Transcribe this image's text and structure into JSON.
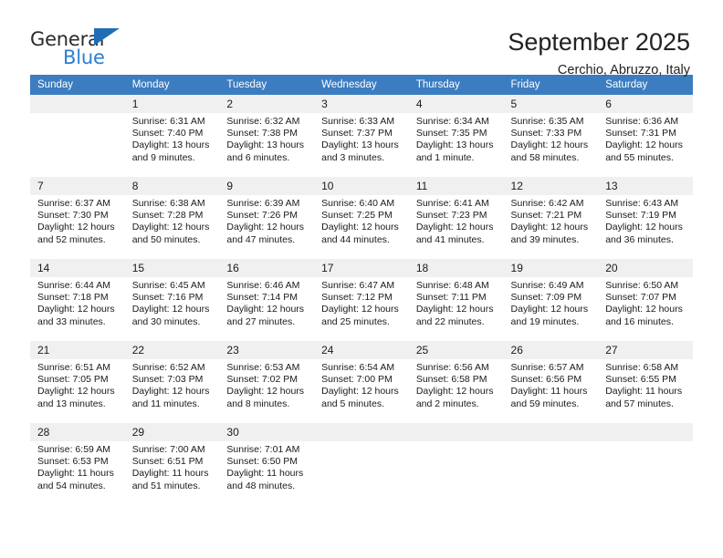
{
  "brand": {
    "line1": "General",
    "line2": "Blue",
    "triangle_color": "#1f6eb5",
    "text_color": "#2b2b2b",
    "blue_text_color": "#2a7fd4"
  },
  "header": {
    "title": "September 2025",
    "subtitle": "Cerchio, Abruzzo, Italy"
  },
  "theme": {
    "header_bg": "#3b7dc0",
    "daynum_bg": "#f0f0f0",
    "grid_line": "#3b7dc0"
  },
  "weekday_headers": [
    "Sunday",
    "Monday",
    "Tuesday",
    "Wednesday",
    "Thursday",
    "Friday",
    "Saturday"
  ],
  "labels": {
    "sunrise_prefix": "Sunrise:",
    "sunset_prefix": "Sunset:",
    "daylight_prefix": "Daylight:"
  },
  "weeks": [
    [
      {
        "day": "",
        "empty": true,
        "sunrise": "",
        "sunset": "",
        "daylight_line1": "",
        "daylight_line2": ""
      },
      {
        "day": "1",
        "sunrise": "Sunrise: 6:31 AM",
        "sunset": "Sunset: 7:40 PM",
        "daylight_line1": "Daylight: 13 hours",
        "daylight_line2": "and 9 minutes."
      },
      {
        "day": "2",
        "sunrise": "Sunrise: 6:32 AM",
        "sunset": "Sunset: 7:38 PM",
        "daylight_line1": "Daylight: 13 hours",
        "daylight_line2": "and 6 minutes."
      },
      {
        "day": "3",
        "sunrise": "Sunrise: 6:33 AM",
        "sunset": "Sunset: 7:37 PM",
        "daylight_line1": "Daylight: 13 hours",
        "daylight_line2": "and 3 minutes."
      },
      {
        "day": "4",
        "sunrise": "Sunrise: 6:34 AM",
        "sunset": "Sunset: 7:35 PM",
        "daylight_line1": "Daylight: 13 hours",
        "daylight_line2": "and 1 minute."
      },
      {
        "day": "5",
        "sunrise": "Sunrise: 6:35 AM",
        "sunset": "Sunset: 7:33 PM",
        "daylight_line1": "Daylight: 12 hours",
        "daylight_line2": "and 58 minutes."
      },
      {
        "day": "6",
        "sunrise": "Sunrise: 6:36 AM",
        "sunset": "Sunset: 7:31 PM",
        "daylight_line1": "Daylight: 12 hours",
        "daylight_line2": "and 55 minutes."
      }
    ],
    [
      {
        "day": "7",
        "sunrise": "Sunrise: 6:37 AM",
        "sunset": "Sunset: 7:30 PM",
        "daylight_line1": "Daylight: 12 hours",
        "daylight_line2": "and 52 minutes."
      },
      {
        "day": "8",
        "sunrise": "Sunrise: 6:38 AM",
        "sunset": "Sunset: 7:28 PM",
        "daylight_line1": "Daylight: 12 hours",
        "daylight_line2": "and 50 minutes."
      },
      {
        "day": "9",
        "sunrise": "Sunrise: 6:39 AM",
        "sunset": "Sunset: 7:26 PM",
        "daylight_line1": "Daylight: 12 hours",
        "daylight_line2": "and 47 minutes."
      },
      {
        "day": "10",
        "sunrise": "Sunrise: 6:40 AM",
        "sunset": "Sunset: 7:25 PM",
        "daylight_line1": "Daylight: 12 hours",
        "daylight_line2": "and 44 minutes."
      },
      {
        "day": "11",
        "sunrise": "Sunrise: 6:41 AM",
        "sunset": "Sunset: 7:23 PM",
        "daylight_line1": "Daylight: 12 hours",
        "daylight_line2": "and 41 minutes."
      },
      {
        "day": "12",
        "sunrise": "Sunrise: 6:42 AM",
        "sunset": "Sunset: 7:21 PM",
        "daylight_line1": "Daylight: 12 hours",
        "daylight_line2": "and 39 minutes."
      },
      {
        "day": "13",
        "sunrise": "Sunrise: 6:43 AM",
        "sunset": "Sunset: 7:19 PM",
        "daylight_line1": "Daylight: 12 hours",
        "daylight_line2": "and 36 minutes."
      }
    ],
    [
      {
        "day": "14",
        "sunrise": "Sunrise: 6:44 AM",
        "sunset": "Sunset: 7:18 PM",
        "daylight_line1": "Daylight: 12 hours",
        "daylight_line2": "and 33 minutes."
      },
      {
        "day": "15",
        "sunrise": "Sunrise: 6:45 AM",
        "sunset": "Sunset: 7:16 PM",
        "daylight_line1": "Daylight: 12 hours",
        "daylight_line2": "and 30 minutes."
      },
      {
        "day": "16",
        "sunrise": "Sunrise: 6:46 AM",
        "sunset": "Sunset: 7:14 PM",
        "daylight_line1": "Daylight: 12 hours",
        "daylight_line2": "and 27 minutes."
      },
      {
        "day": "17",
        "sunrise": "Sunrise: 6:47 AM",
        "sunset": "Sunset: 7:12 PM",
        "daylight_line1": "Daylight: 12 hours",
        "daylight_line2": "and 25 minutes."
      },
      {
        "day": "18",
        "sunrise": "Sunrise: 6:48 AM",
        "sunset": "Sunset: 7:11 PM",
        "daylight_line1": "Daylight: 12 hours",
        "daylight_line2": "and 22 minutes."
      },
      {
        "day": "19",
        "sunrise": "Sunrise: 6:49 AM",
        "sunset": "Sunset: 7:09 PM",
        "daylight_line1": "Daylight: 12 hours",
        "daylight_line2": "and 19 minutes."
      },
      {
        "day": "20",
        "sunrise": "Sunrise: 6:50 AM",
        "sunset": "Sunset: 7:07 PM",
        "daylight_line1": "Daylight: 12 hours",
        "daylight_line2": "and 16 minutes."
      }
    ],
    [
      {
        "day": "21",
        "sunrise": "Sunrise: 6:51 AM",
        "sunset": "Sunset: 7:05 PM",
        "daylight_line1": "Daylight: 12 hours",
        "daylight_line2": "and 13 minutes."
      },
      {
        "day": "22",
        "sunrise": "Sunrise: 6:52 AM",
        "sunset": "Sunset: 7:03 PM",
        "daylight_line1": "Daylight: 12 hours",
        "daylight_line2": "and 11 minutes."
      },
      {
        "day": "23",
        "sunrise": "Sunrise: 6:53 AM",
        "sunset": "Sunset: 7:02 PM",
        "daylight_line1": "Daylight: 12 hours",
        "daylight_line2": "and 8 minutes."
      },
      {
        "day": "24",
        "sunrise": "Sunrise: 6:54 AM",
        "sunset": "Sunset: 7:00 PM",
        "daylight_line1": "Daylight: 12 hours",
        "daylight_line2": "and 5 minutes."
      },
      {
        "day": "25",
        "sunrise": "Sunrise: 6:56 AM",
        "sunset": "Sunset: 6:58 PM",
        "daylight_line1": "Daylight: 12 hours",
        "daylight_line2": "and 2 minutes."
      },
      {
        "day": "26",
        "sunrise": "Sunrise: 6:57 AM",
        "sunset": "Sunset: 6:56 PM",
        "daylight_line1": "Daylight: 11 hours",
        "daylight_line2": "and 59 minutes."
      },
      {
        "day": "27",
        "sunrise": "Sunrise: 6:58 AM",
        "sunset": "Sunset: 6:55 PM",
        "daylight_line1": "Daylight: 11 hours",
        "daylight_line2": "and 57 minutes."
      }
    ],
    [
      {
        "day": "28",
        "sunrise": "Sunrise: 6:59 AM",
        "sunset": "Sunset: 6:53 PM",
        "daylight_line1": "Daylight: 11 hours",
        "daylight_line2": "and 54 minutes."
      },
      {
        "day": "29",
        "sunrise": "Sunrise: 7:00 AM",
        "sunset": "Sunset: 6:51 PM",
        "daylight_line1": "Daylight: 11 hours",
        "daylight_line2": "and 51 minutes."
      },
      {
        "day": "30",
        "sunrise": "Sunrise: 7:01 AM",
        "sunset": "Sunset: 6:50 PM",
        "daylight_line1": "Daylight: 11 hours",
        "daylight_line2": "and 48 minutes."
      },
      {
        "day": "",
        "empty": true,
        "sunrise": "",
        "sunset": "",
        "daylight_line1": "",
        "daylight_line2": ""
      },
      {
        "day": "",
        "empty": true,
        "sunrise": "",
        "sunset": "",
        "daylight_line1": "",
        "daylight_line2": ""
      },
      {
        "day": "",
        "empty": true,
        "sunrise": "",
        "sunset": "",
        "daylight_line1": "",
        "daylight_line2": ""
      },
      {
        "day": "",
        "empty": true,
        "sunrise": "",
        "sunset": "",
        "daylight_line1": "",
        "daylight_line2": ""
      }
    ]
  ]
}
